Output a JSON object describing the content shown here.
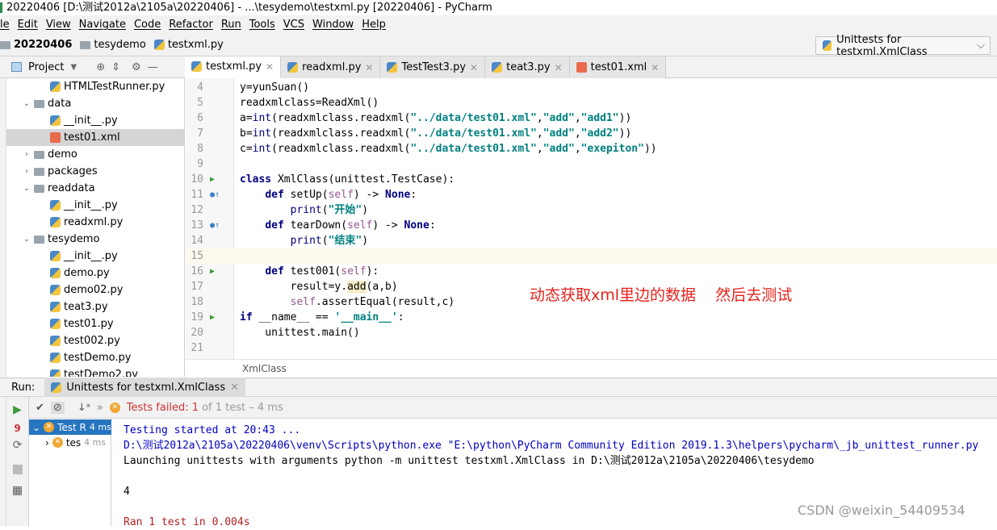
{
  "title": "20220406 [D:\\测试2012a\\2105a\\20220406] - ...\\tesydemo\\testxml.py [20220406] - PyCharm",
  "menu": [
    "le",
    "Edit",
    "View",
    "Navigate",
    "Code",
    "Refactor",
    "Run",
    "Tools",
    "VCS",
    "Window",
    "Help"
  ],
  "breadcrumb": [
    "20220406",
    "tesydemo",
    "testxml.py"
  ],
  "run_config": "Unittests for testxml.XmlClass",
  "project_label": "Project",
  "tree": [
    {
      "label": "HTMLTestRunner.py",
      "type": "py",
      "indent": 2
    },
    {
      "label": "data",
      "type": "folder",
      "indent": 1,
      "open": true
    },
    {
      "label": "__init__.py",
      "type": "py",
      "indent": 2
    },
    {
      "label": "test01.xml",
      "type": "xml",
      "indent": 2,
      "selected": true
    },
    {
      "label": "demo",
      "type": "folder",
      "indent": 1,
      "open": false
    },
    {
      "label": "packages",
      "type": "folder",
      "indent": 1,
      "open": false
    },
    {
      "label": "readdata",
      "type": "folder",
      "indent": 1,
      "open": true
    },
    {
      "label": "__init__.py",
      "type": "py",
      "indent": 2
    },
    {
      "label": "readxml.py",
      "type": "py",
      "indent": 2
    },
    {
      "label": "tesydemo",
      "type": "folder",
      "indent": 1,
      "open": true
    },
    {
      "label": "__init__.py",
      "type": "py",
      "indent": 2
    },
    {
      "label": "demo.py",
      "type": "py",
      "indent": 2
    },
    {
      "label": "demo02.py",
      "type": "py",
      "indent": 2
    },
    {
      "label": "teat3.py",
      "type": "py",
      "indent": 2
    },
    {
      "label": "test01.py",
      "type": "py",
      "indent": 2
    },
    {
      "label": "test002.py",
      "type": "py",
      "indent": 2
    },
    {
      "label": "testDemo.py",
      "type": "py",
      "indent": 2
    },
    {
      "label": "testDemo2.py",
      "type": "py",
      "indent": 2
    }
  ],
  "tabs": [
    {
      "label": "testxml.py",
      "type": "py",
      "active": true
    },
    {
      "label": "readxml.py",
      "type": "py"
    },
    {
      "label": "TestTest3.py",
      "type": "py"
    },
    {
      "label": "teat3.py",
      "type": "py"
    },
    {
      "label": "test01.xml",
      "type": "xml"
    }
  ],
  "code": [
    {
      "n": "4",
      "t": [
        [
          "",
          "y=yunSuan()"
        ]
      ]
    },
    {
      "n": "5",
      "t": [
        [
          "",
          "readxmlclass=ReadXml()"
        ]
      ]
    },
    {
      "n": "6",
      "t": [
        [
          "",
          "a="
        ],
        [
          "bi",
          "int"
        ],
        [
          "",
          "(readxmlclass.readxml("
        ],
        [
          "str",
          "\"../data/test01.xml\""
        ],
        [
          "",
          ","
        ],
        [
          "str",
          "\"add\""
        ],
        [
          "",
          ","
        ],
        [
          "str",
          "\"add1\""
        ],
        [
          "",
          "))"
        ]
      ]
    },
    {
      "n": "7",
      "t": [
        [
          "",
          "b="
        ],
        [
          "bi",
          "int"
        ],
        [
          "",
          "(readxmlclass.readxml("
        ],
        [
          "str",
          "\"../data/test01.xml\""
        ],
        [
          "",
          ","
        ],
        [
          "str",
          "\"add\""
        ],
        [
          "",
          ","
        ],
        [
          "str",
          "\"add2\""
        ],
        [
          "",
          "))"
        ]
      ]
    },
    {
      "n": "8",
      "t": [
        [
          "",
          "c="
        ],
        [
          "bi",
          "int"
        ],
        [
          "",
          "(readxmlclass.readxml("
        ],
        [
          "str",
          "\"../data/test01.xml\""
        ],
        [
          "",
          ","
        ],
        [
          "str",
          "\"add\""
        ],
        [
          "",
          ","
        ],
        [
          "str",
          "\"exepiton\""
        ],
        [
          "",
          "))"
        ]
      ]
    },
    {
      "n": "9",
      "t": []
    },
    {
      "n": "10",
      "mark": "run",
      "t": [
        [
          "kw",
          "class"
        ],
        [
          "",
          " XmlClass(unittest.TestCase):"
        ]
      ]
    },
    {
      "n": "11",
      "mark": "override",
      "t": [
        [
          "",
          "    "
        ],
        [
          "kw",
          "def"
        ],
        [
          "",
          " setUp("
        ],
        [
          "self",
          "self"
        ],
        [
          "",
          ") -> "
        ],
        [
          "kw",
          "None"
        ],
        [
          "",
          ":"
        ]
      ]
    },
    {
      "n": "12",
      "t": [
        [
          "",
          "        "
        ],
        [
          "bi",
          "print"
        ],
        [
          "",
          "("
        ],
        [
          "str",
          "\"开始\""
        ],
        [
          "",
          ")"
        ]
      ]
    },
    {
      "n": "13",
      "mark": "override",
      "t": [
        [
          "",
          "    "
        ],
        [
          "kw",
          "def"
        ],
        [
          "",
          " tearDown("
        ],
        [
          "self",
          "self"
        ],
        [
          "",
          ") -> "
        ],
        [
          "kw",
          "None"
        ],
        [
          "",
          ":"
        ]
      ]
    },
    {
      "n": "14",
      "t": [
        [
          "",
          "        "
        ],
        [
          "bi",
          "print"
        ],
        [
          "",
          "("
        ],
        [
          "str",
          "\"结束\""
        ],
        [
          "",
          ")"
        ]
      ]
    },
    {
      "n": "15",
      "current": true,
      "t": []
    },
    {
      "n": "16",
      "mark": "run",
      "t": [
        [
          "",
          "    "
        ],
        [
          "kw",
          "def"
        ],
        [
          "",
          " test001("
        ],
        [
          "self",
          "self"
        ],
        [
          "",
          "):"
        ]
      ]
    },
    {
      "n": "17",
      "t": [
        [
          "",
          "        result=y."
        ],
        [
          "hl",
          "add"
        ],
        [
          "",
          "(a,b)"
        ]
      ]
    },
    {
      "n": "18",
      "t": [
        [
          "",
          "        "
        ],
        [
          "self",
          "self"
        ],
        [
          "",
          ".assertEqual(result,c)"
        ]
      ]
    },
    {
      "n": "19",
      "mark": "run",
      "t": [
        [
          "kw",
          "if"
        ],
        [
          "",
          " __name__ == "
        ],
        [
          "str",
          "'__main__'"
        ],
        [
          "",
          ":"
        ]
      ]
    },
    {
      "n": "20",
      "t": [
        [
          "",
          "    unittest.main()"
        ]
      ]
    },
    {
      "n": "21",
      "t": []
    }
  ],
  "annotation": "动态获取xml里边的数据    然后去测试",
  "editor_breadcrumb": "XmlClass",
  "run": {
    "label": "Run:",
    "tab": "Unittests for testxml.XmlClass",
    "status_failed": "Tests failed: 1",
    "status_rest": "of 1 test – 4 ms",
    "tree": [
      {
        "label": "Test R",
        "time": "4 ms"
      },
      {
        "label": "tes",
        "time": "4 ms"
      }
    ],
    "console": [
      {
        "cls": "blue",
        "text": "Testing started at 20:43 ..."
      },
      {
        "cls": "blue",
        "text": "D:\\测试2012a\\2105a\\20220406\\venv\\Scripts\\python.exe \"E:\\python\\PyCharm Community Edition 2019.1.3\\helpers\\pycharm\\_jb_unittest_runner.py"
      },
      {
        "cls": "",
        "text": "Launching unittests with arguments python -m unittest testxml.XmlClass in D:\\测试2012a\\2105a\\20220406\\tesydemo"
      },
      {
        "cls": "",
        "text": ""
      },
      {
        "cls": "",
        "text": "4"
      },
      {
        "cls": "",
        "text": ""
      },
      {
        "cls": "red",
        "text": "Ran 1 test in 0.004s"
      }
    ]
  },
  "watermark": "CSDN @weixin_54409534"
}
